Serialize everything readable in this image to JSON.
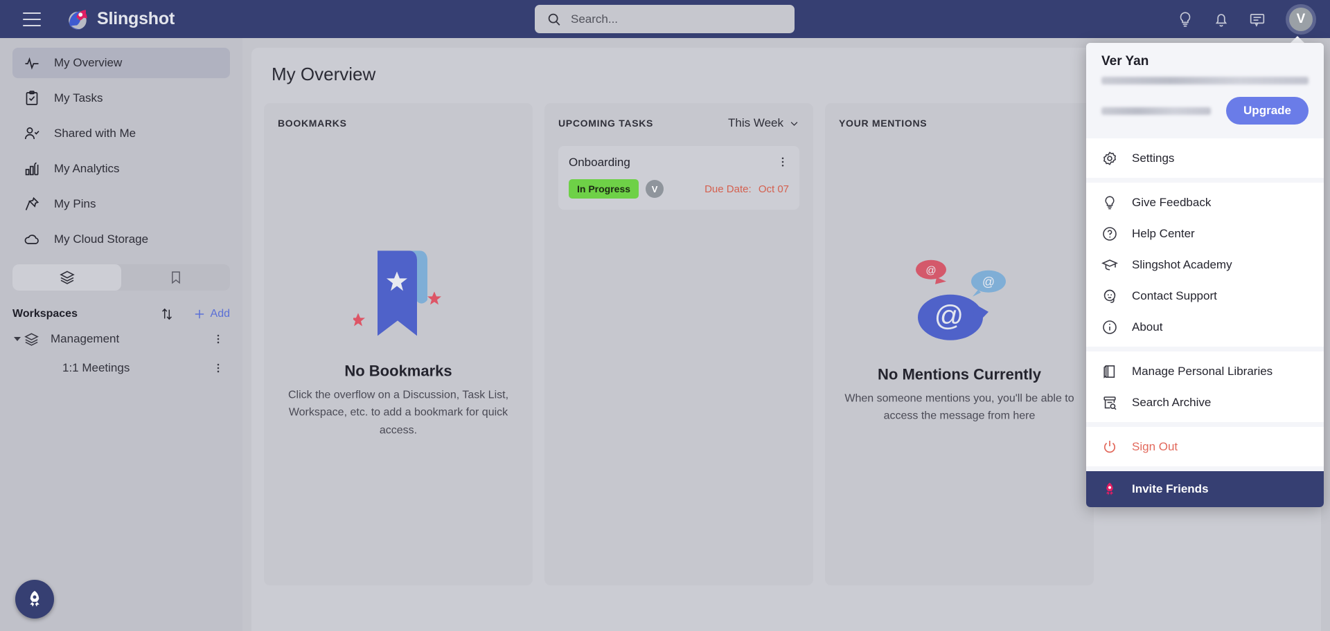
{
  "topbar": {
    "menu_icon": "hamburger-icon",
    "brand": "Slingshot",
    "search_placeholder": "Search...",
    "search_value": "",
    "icons": [
      "lightbulb-icon",
      "bell-icon",
      "chat-icon"
    ],
    "avatar_initial": "V"
  },
  "sidebar": {
    "items": [
      {
        "label": "My Overview",
        "icon": "pulse-icon",
        "active": true
      },
      {
        "label": "My Tasks",
        "icon": "tasks-icon",
        "active": false
      },
      {
        "label": "Shared with Me",
        "icon": "shared-icon",
        "active": false
      },
      {
        "label": "My Analytics",
        "icon": "chart-icon",
        "active": false
      },
      {
        "label": "My Pins",
        "icon": "pin-icon",
        "active": false
      },
      {
        "label": "My Cloud Storage",
        "icon": "cloud-icon",
        "active": false
      }
    ],
    "tabs": [
      {
        "icon": "layers-icon",
        "selected": true
      },
      {
        "icon": "bookmark-icon",
        "selected": false
      }
    ],
    "workspaces": {
      "title": "Workspaces",
      "sort_icon": "sort-icon",
      "add_label": "Add",
      "tree": [
        {
          "name": "Management",
          "icon": "layers-icon",
          "expanded": true,
          "child": false
        },
        {
          "name": "1:1 Meetings",
          "icon": "",
          "expanded": false,
          "child": true
        }
      ]
    }
  },
  "main": {
    "page_title": "My Overview",
    "bookmarks": {
      "title": "BOOKMARKS",
      "empty_title": "No Bookmarks",
      "empty_sub": "Click the overflow on a Discussion, Task List, Workspace, etc. to add a bookmark for quick access."
    },
    "upcoming": {
      "title": "UPCOMING TASKS",
      "filter": "This Week",
      "tasks": [
        {
          "name": "Onboarding",
          "status": "In Progress",
          "assignee": "V",
          "due_label": "Due Date:",
          "due_value": "Oct 07"
        }
      ]
    },
    "mentions": {
      "title": "YOUR MENTIONS",
      "empty_title": "No Mentions Currently",
      "empty_sub": "When someone mentions you, you'll be able to access the message from here"
    }
  },
  "profile_menu": {
    "user_name": "Ver Yan",
    "email_redacted": true,
    "trial_redacted": true,
    "upgrade_label": "Upgrade",
    "groups": [
      [
        {
          "label": "Settings",
          "icon": "gear-icon"
        }
      ],
      [
        {
          "label": "Give Feedback",
          "icon": "lightbulb-icon"
        },
        {
          "label": "Help Center",
          "icon": "question-icon"
        },
        {
          "label": "Slingshot Academy",
          "icon": "graduation-icon"
        },
        {
          "label": "Contact Support",
          "icon": "headset-icon"
        },
        {
          "label": "About",
          "icon": "info-icon"
        }
      ],
      [
        {
          "label": "Manage Personal Libraries",
          "icon": "book-icon"
        },
        {
          "label": "Search Archive",
          "icon": "archive-search-icon"
        }
      ],
      [
        {
          "label": "Sign Out",
          "icon": "power-icon",
          "style": "signout"
        }
      ],
      [
        {
          "label": "Invite Friends",
          "icon": "rocket-icon",
          "style": "invite"
        }
      ]
    ]
  },
  "fab": {
    "icon": "rocket-icon"
  },
  "colors": {
    "brand_navy": "#363f72",
    "accent_blue": "#6a7ce8",
    "status_green": "#6ed147",
    "danger_red": "#e2695c",
    "due_red": "#d4604f",
    "pink": "#e01e63"
  }
}
